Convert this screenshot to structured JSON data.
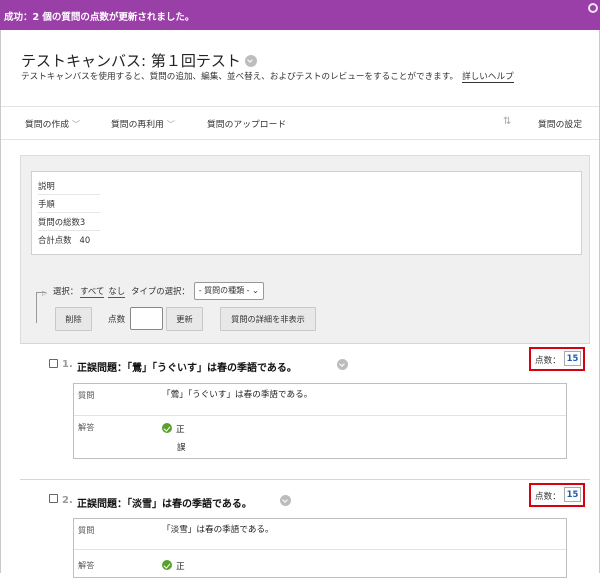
{
  "banner": {
    "message": "成功：2 個の質問の点数が更新されました。"
  },
  "header": {
    "title": "テストキャンバス: 第１回テスト",
    "description": "テストキャンバスを使用すると、質問の追加、編集、並べ替え、およびテストのレビューをすることができます。",
    "help_link": "詳しいヘルプ"
  },
  "toolbar": {
    "create": "質問の作成",
    "reuse": "質問の再利用",
    "upload": "質問のアップロード",
    "settings": "質問の設定"
  },
  "info": {
    "rows": [
      {
        "label": "説明",
        "value": ""
      },
      {
        "label": "手順",
        "value": ""
      },
      {
        "label": "質問の総数",
        "value": "3"
      },
      {
        "label": "合計点数",
        "value": "40"
      }
    ]
  },
  "selection": {
    "select_label": "選択：",
    "all": "すべて",
    "none": "なし",
    "type_label": "タイプの選択：",
    "type_default": "- 質問の種類 -",
    "delete_button": "削除",
    "points_label": "点数",
    "update_button": "更新",
    "hide_details_button": "質問の詳細を非表示"
  },
  "questions": [
    {
      "number": "1.",
      "title": "正誤問題：「鶯」「うぐいす」は春の季語である。",
      "score_label": "点数：",
      "score": "15",
      "question_label": "質問",
      "question_text": "「鶯」「うぐいす」は春の季語である。",
      "answer_label": "解答",
      "answers": [
        "正",
        "誤"
      ]
    },
    {
      "number": "2.",
      "title": "正誤問題：「淡雪」は春の季語である。",
      "score_label": "点数：",
      "score": "15",
      "question_label": "質問",
      "question_text": "「淡雪」は春の季語である。",
      "answer_label": "解答",
      "answers": [
        "正"
      ]
    }
  ],
  "colors": {
    "banner": "#9a3fa7",
    "highlight_border": "#d9000d",
    "check": "#5aa02c",
    "score_value": "#1a5fa8"
  }
}
